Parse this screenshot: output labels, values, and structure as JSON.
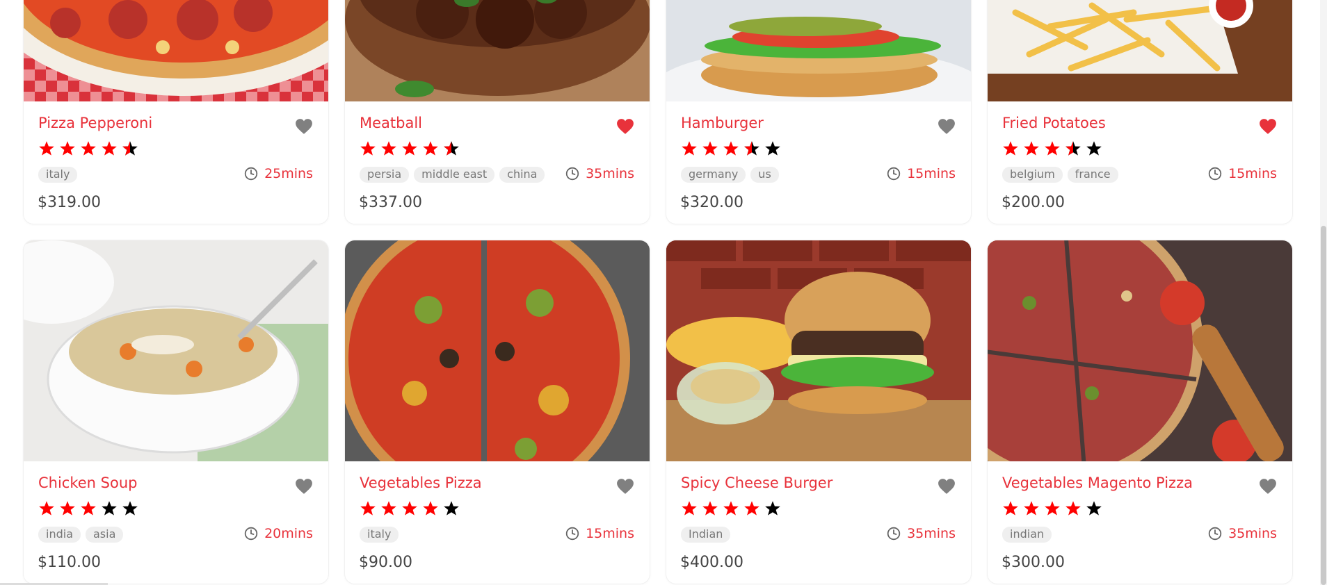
{
  "colors": {
    "accent": "#e8323b",
    "star_filled": "#ff0000",
    "star_empty": "#000000",
    "heart_inactive": "#808080",
    "heart_active": "#e8323b",
    "tag_bg": "#efefef"
  },
  "products": [
    {
      "name": "Pizza Pepperoni",
      "rating": 4.5,
      "favorite": false,
      "tags": [
        "italy"
      ],
      "time": "25mins",
      "price": "$319.00",
      "image": "pizza-pepperoni"
    },
    {
      "name": "Meatball",
      "rating": 4.5,
      "favorite": true,
      "tags": [
        "persia",
        "middle east",
        "china"
      ],
      "time": "35mins",
      "price": "$337.00",
      "image": "meatball-bowl"
    },
    {
      "name": "Hamburger",
      "rating": 3.5,
      "favorite": false,
      "tags": [
        "germany",
        "us"
      ],
      "time": "15mins",
      "price": "$320.00",
      "image": "hamburger"
    },
    {
      "name": "Fried Potatoes",
      "rating": 3.5,
      "favorite": true,
      "tags": [
        "belgium",
        "france"
      ],
      "time": "15mins",
      "price": "$200.00",
      "image": "fried-potatoes"
    },
    {
      "name": "Chicken Soup",
      "rating": 3,
      "favorite": false,
      "tags": [
        "india",
        "asia"
      ],
      "time": "20mins",
      "price": "$110.00",
      "image": "chicken-soup"
    },
    {
      "name": "Vegetables Pizza",
      "rating": 4,
      "favorite": false,
      "tags": [
        "italy"
      ],
      "time": "15mins",
      "price": "$90.00",
      "image": "vegetables-pizza"
    },
    {
      "name": "Spicy Cheese Burger",
      "rating": 4,
      "favorite": false,
      "tags": [
        "Indian"
      ],
      "time": "35mins",
      "price": "$400.00",
      "image": "spicy-cheese-burger"
    },
    {
      "name": "Vegetables Magento Pizza",
      "rating": 4,
      "favorite": false,
      "tags": [
        "indian"
      ],
      "time": "35mins",
      "price": "$300.00",
      "image": "vegetables-magento-pizza"
    }
  ]
}
